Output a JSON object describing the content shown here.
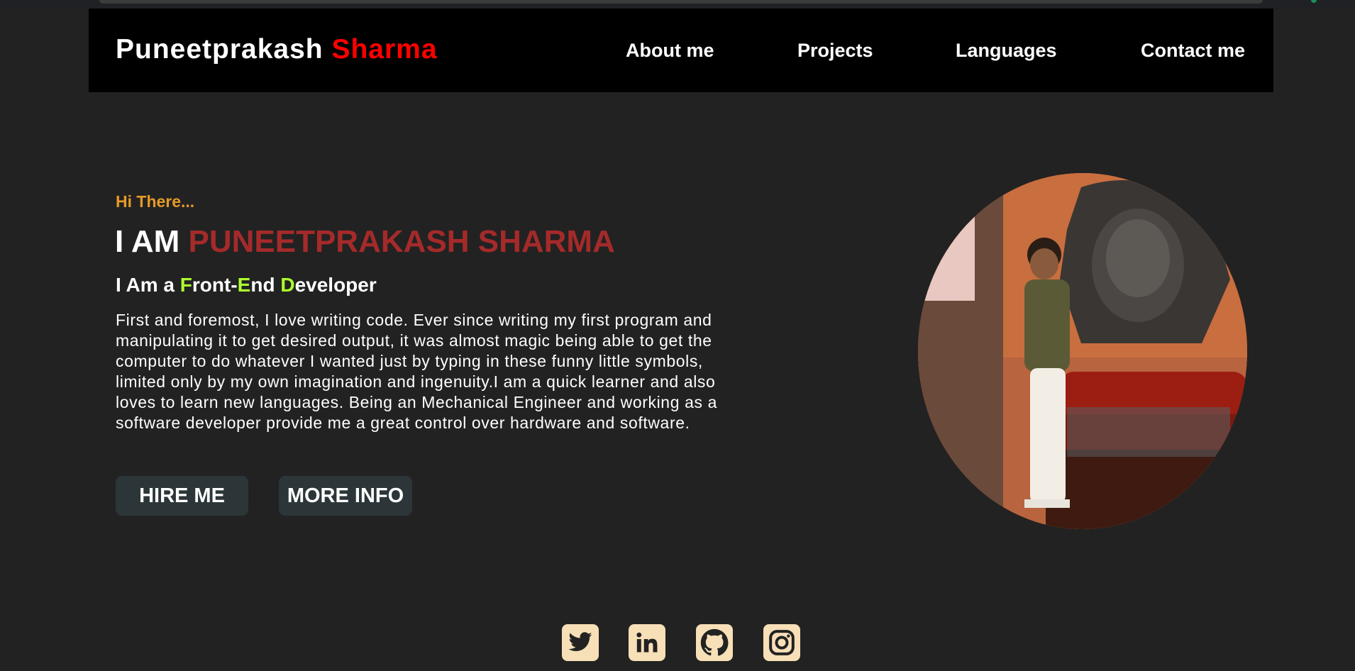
{
  "nav": {
    "brand_first": "Puneetprakash",
    "brand_last": "Sharma",
    "links": [
      "About me",
      "Projects",
      "Languages",
      "Contact me"
    ]
  },
  "hero": {
    "greeting": "Hi There...",
    "headline_prefix": "I AM",
    "headline_name": "PUNEETPRAKASH SHARMA",
    "role": {
      "prefix": "I Am a ",
      "f": "F",
      "ront": "ront-",
      "e": "E",
      "nd": "nd ",
      "d": "D",
      "eveloper": "eveloper"
    },
    "bio": "First and foremost, I love writing code. Ever since writing my first program and manipulating it to get desired output, it was almost magic being able to get the computer to do whatever I wanted just by typing in these funny little symbols, limited only by my own imagination and ingenuity.I am a quick learner and also loves to learn new languages. Being an Mechanical Engineer and working as a software developer provide me a great control over hardware and software.",
    "buttons": {
      "hire": "HIRE ME",
      "more": "MORE INFO"
    }
  },
  "social": [
    "twitter-icon",
    "linkedin-icon",
    "github-icon",
    "instagram-icon"
  ],
  "colors": {
    "background": "#222222",
    "navbar": "#000000",
    "brand_accent": "#ff0000",
    "greeting": "#e69a28",
    "name": "#a52a2a",
    "role_highlight": "#adff2f",
    "button_bg": "#2c3638",
    "social_icon_bg": "#f7dfb7"
  }
}
